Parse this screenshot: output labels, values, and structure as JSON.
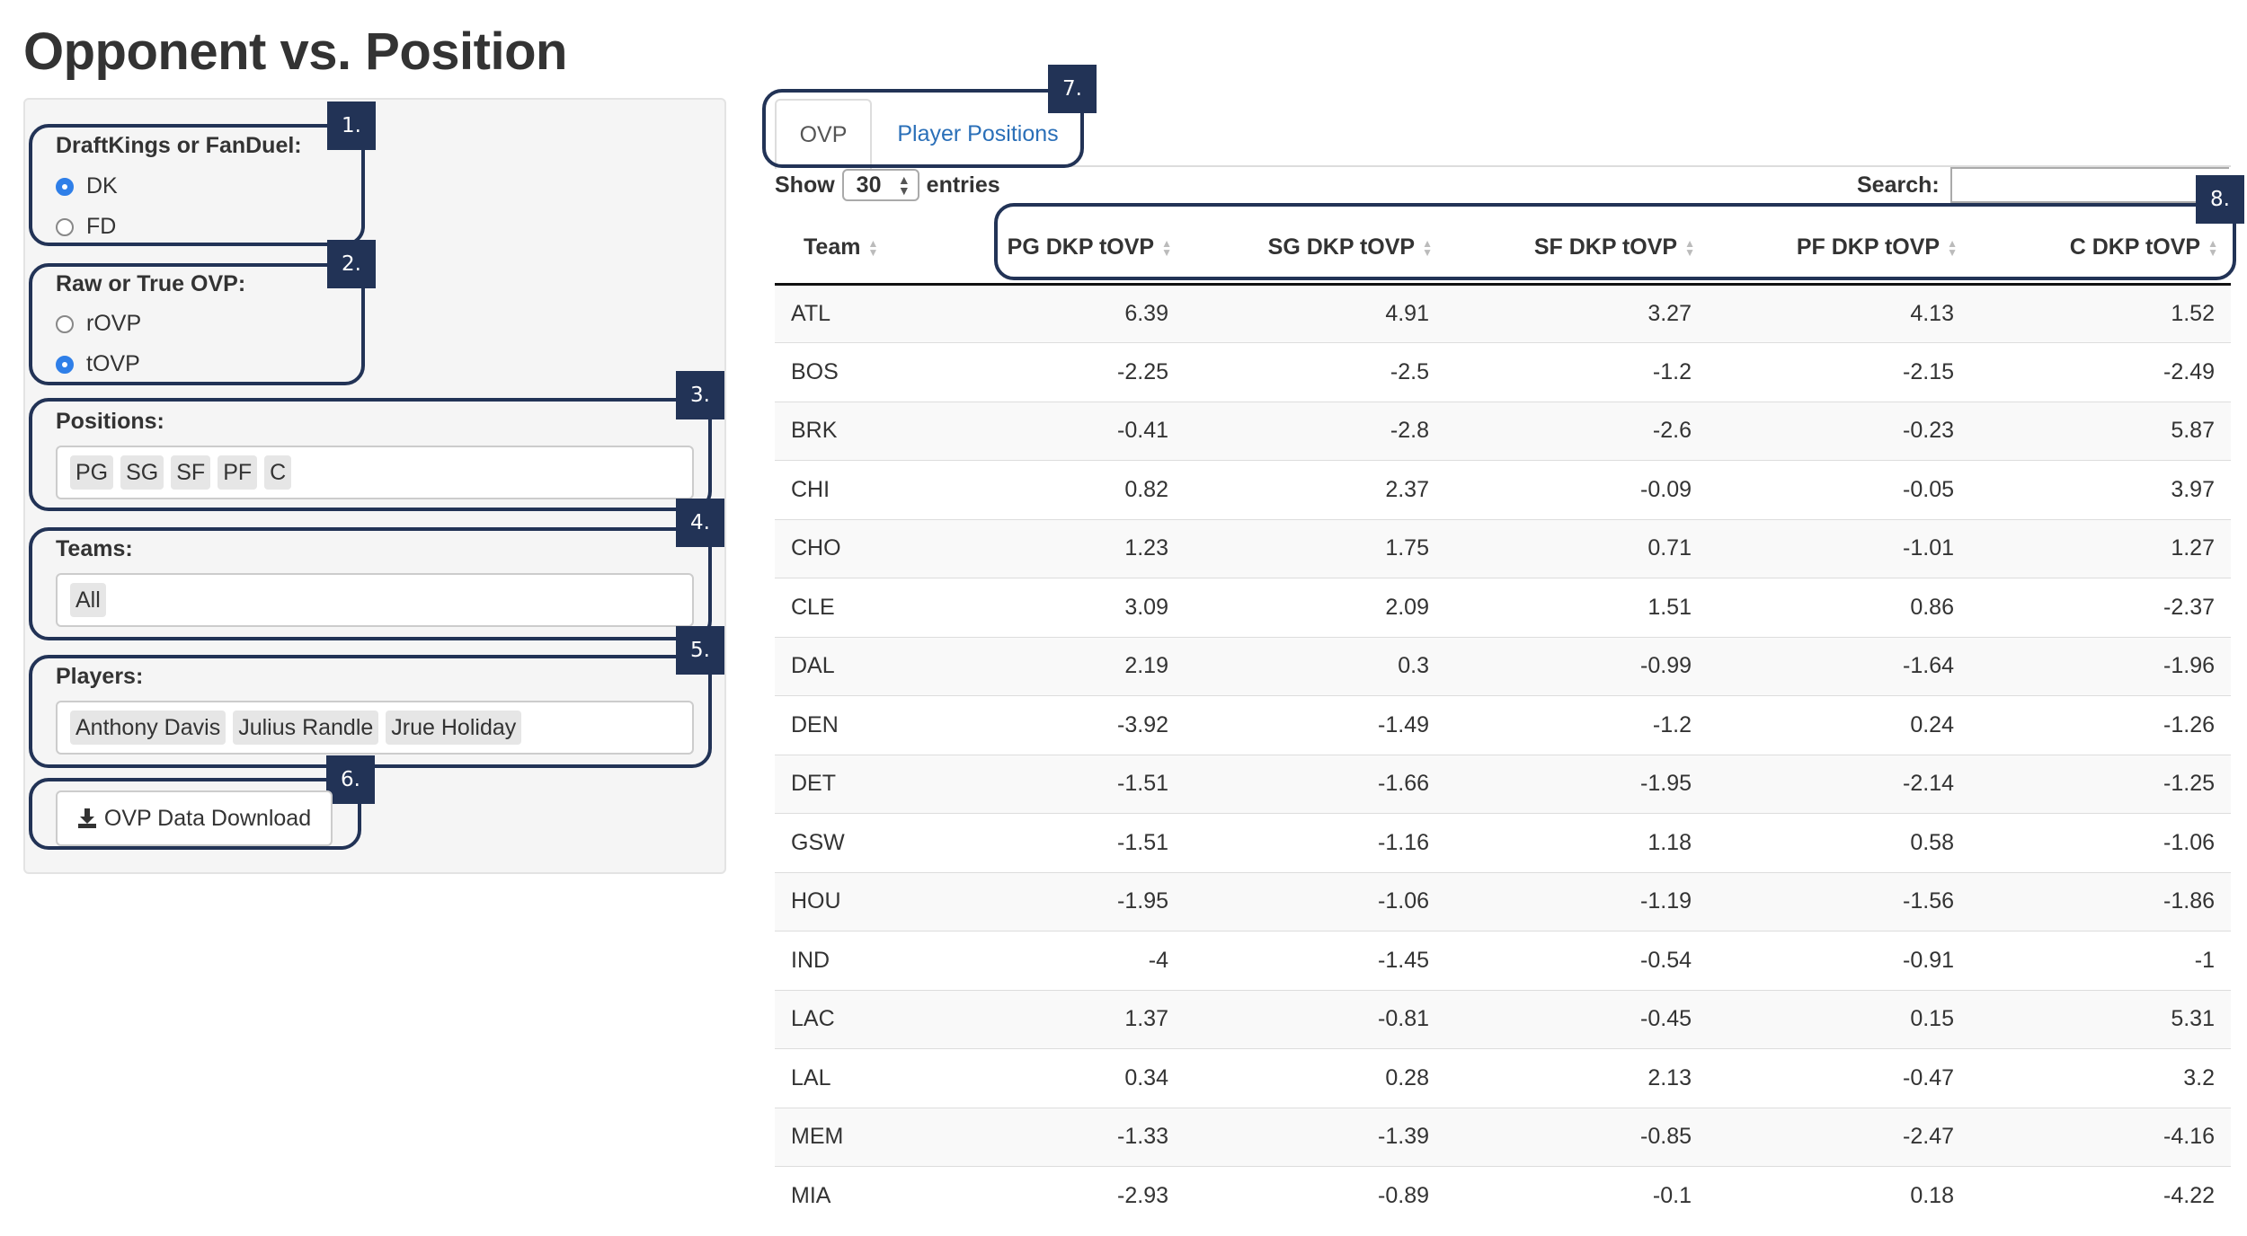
{
  "title": "Opponent vs. Position",
  "sidebar": {
    "site": {
      "label": "DraftKings or FanDuel:",
      "options": [
        "DK",
        "FD"
      ],
      "selected": "DK"
    },
    "ovp_type": {
      "label": "Raw or True OVP:",
      "options": [
        "rOVP",
        "tOVP"
      ],
      "selected": "tOVP"
    },
    "positions": {
      "label": "Positions:",
      "values": [
        "PG",
        "SG",
        "SF",
        "PF",
        "C"
      ]
    },
    "teams": {
      "label": "Teams:",
      "values": [
        "All"
      ]
    },
    "players": {
      "label": "Players:",
      "values": [
        "Anthony Davis",
        "Julius Randle",
        "Jrue Holiday"
      ]
    },
    "download_label": "OVP Data Download"
  },
  "callouts": [
    "1.",
    "2.",
    "3.",
    "4.",
    "5.",
    "6.",
    "7.",
    "8."
  ],
  "tabs": [
    "OVP",
    "Player Positions"
  ],
  "active_tab": "OVP",
  "table_controls": {
    "show_label": "Show",
    "page_length": "30",
    "entries_label": "entries",
    "search_label": "Search:",
    "search_value": ""
  },
  "table": {
    "columns": [
      "Team",
      "PG DKP tOVP",
      "SG DKP tOVP",
      "SF DKP tOVP",
      "PF DKP tOVP",
      "C DKP tOVP"
    ],
    "rows": [
      [
        "ATL",
        "6.39",
        "4.91",
        "3.27",
        "4.13",
        "1.52"
      ],
      [
        "BOS",
        "-2.25",
        "-2.5",
        "-1.2",
        "-2.15",
        "-2.49"
      ],
      [
        "BRK",
        "-0.41",
        "-2.8",
        "-2.6",
        "-0.23",
        "5.87"
      ],
      [
        "CHI",
        "0.82",
        "2.37",
        "-0.09",
        "-0.05",
        "3.97"
      ],
      [
        "CHO",
        "1.23",
        "1.75",
        "0.71",
        "-1.01",
        "1.27"
      ],
      [
        "CLE",
        "3.09",
        "2.09",
        "1.51",
        "0.86",
        "-2.37"
      ],
      [
        "DAL",
        "2.19",
        "0.3",
        "-0.99",
        "-1.64",
        "-1.96"
      ],
      [
        "DEN",
        "-3.92",
        "-1.49",
        "-1.2",
        "0.24",
        "-1.26"
      ],
      [
        "DET",
        "-1.51",
        "-1.66",
        "-1.95",
        "-2.14",
        "-1.25"
      ],
      [
        "GSW",
        "-1.51",
        "-1.16",
        "1.18",
        "0.58",
        "-1.06"
      ],
      [
        "HOU",
        "-1.95",
        "-1.06",
        "-1.19",
        "-1.56",
        "-1.86"
      ],
      [
        "IND",
        "-4",
        "-1.45",
        "-0.54",
        "-0.91",
        "-1"
      ],
      [
        "LAC",
        "1.37",
        "-0.81",
        "-0.45",
        "0.15",
        "5.31"
      ],
      [
        "LAL",
        "0.34",
        "0.28",
        "2.13",
        "-0.47",
        "3.2"
      ],
      [
        "MEM",
        "-1.33",
        "-1.39",
        "-0.85",
        "-2.47",
        "-4.16"
      ],
      [
        "MIA",
        "-2.93",
        "-0.89",
        "-0.1",
        "0.18",
        "-4.22"
      ]
    ]
  },
  "colors": {
    "accent": "#223356",
    "link": "#2a6fb8",
    "radio_checked": "#2f7fe8"
  }
}
